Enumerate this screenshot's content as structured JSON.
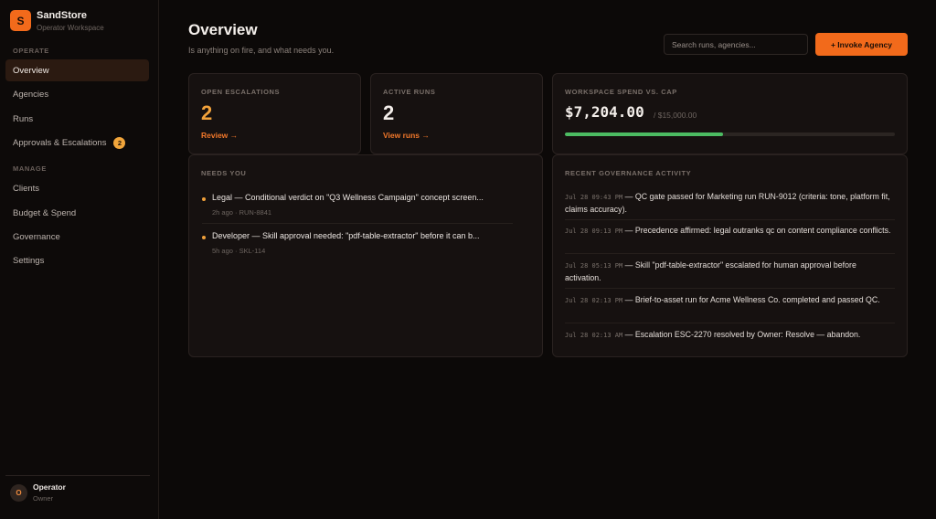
{
  "sidebar": {
    "brand_name": "SandStore",
    "brand_sub": "Operator Workspace",
    "logo_letter": "S",
    "sections": {
      "operate": "OPERATE",
      "manage": "MANAGE"
    },
    "items": [
      {
        "label": "Overview",
        "active": true
      },
      {
        "label": "Agencies"
      },
      {
        "label": "Runs"
      },
      {
        "label": "Approvals & Escalations",
        "badge": "2"
      },
      {
        "label": "Clients"
      },
      {
        "label": "Budget & Spend"
      },
      {
        "label": "Governance"
      },
      {
        "label": "Settings"
      }
    ],
    "user": {
      "initial": "O",
      "name": "Operator",
      "role": "Owner"
    }
  },
  "header": {
    "title": "Overview",
    "subtitle": "Is anything on fire, and what needs you.",
    "search_placeholder": "Search runs, agencies...",
    "invoke_label": "+ Invoke Agency"
  },
  "stats": {
    "escalations": {
      "label": "OPEN ESCALATIONS",
      "value": "2",
      "link": "Review →"
    },
    "runs": {
      "label": "ACTIVE RUNS",
      "value": "2",
      "link": "View runs →"
    },
    "spend": {
      "label": "WORKSPACE SPEND VS. CAP",
      "value": "$7,204.00",
      "cap": "/ $15,000.00",
      "fraction": 0.48
    }
  },
  "needs_you": {
    "label": "NEEDS YOU",
    "items": [
      {
        "title": "Legal — Conditional verdict on \"Q3 Wellness Campaign\" concept screen...",
        "meta": "2h ago · RUN-8841"
      },
      {
        "title": "Developer — Skill approval needed: \"pdf-table-extractor\" before it can b...",
        "meta": "5h ago · SKL-114"
      }
    ]
  },
  "activity": {
    "label": "RECENT GOVERNANCE ACTIVITY",
    "items": [
      {
        "time": "Jul 28 09:43 PM",
        "text": " — QC gate passed for Marketing run RUN-9012 (criteria: tone, platform fit, claims accuracy)."
      },
      {
        "time": "Jul 28 09:13 PM",
        "text": " — Precedence affirmed: legal outranks qc on content compliance conflicts."
      },
      {
        "time": "Jul 28 05:13 PM",
        "text": " — Skill \"pdf-table-extractor\" escalated for human approval before activation."
      },
      {
        "time": "Jul 28 02:13 PM",
        "text": " — Brief-to-asset run for Acme Wellness Co. completed and passed QC."
      },
      {
        "time": "Jul 28 02:13 AM",
        "text": " — Escalation ESC-2270 resolved by Owner: Resolve — abandon."
      }
    ]
  }
}
